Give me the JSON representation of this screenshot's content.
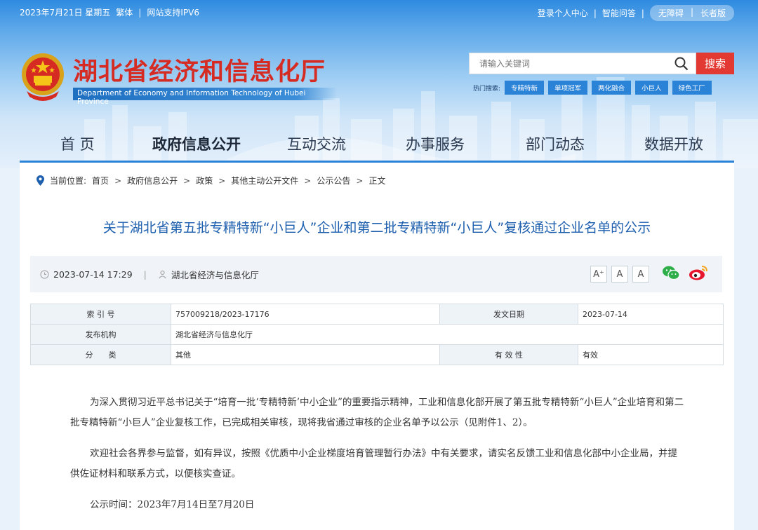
{
  "topbar": {
    "date": "2023年7月21日 星期五",
    "traditional": "繁体",
    "ipv6": "网站支持IPV6",
    "login": "登录个人中心",
    "qa": "智能问答",
    "accessible": "无障碍",
    "elder": "长者版"
  },
  "site": {
    "title": "湖北省经济和信息化厅",
    "subtitle_en": "Department of Economy and Information Technology of Hubei Province"
  },
  "search": {
    "placeholder": "请输入关键词",
    "button": "搜索",
    "hot_label": "热门搜索:",
    "hot_tags": [
      "专精特新",
      "单项冠军",
      "两化融合",
      "小巨人",
      "绿色工厂"
    ]
  },
  "nav": [
    "首 页",
    "政府信息公开",
    "互动交流",
    "办事服务",
    "部门动态",
    "数据开放"
  ],
  "breadcrumb": {
    "label": "当前位置:",
    "items": [
      "首页",
      "政府信息公开",
      "政策",
      "其他主动公开文件",
      "公示公告",
      "正文"
    ]
  },
  "article": {
    "title": "关于湖北省第五批专精特新“小巨人”企业和第二批专精特新“小巨人”复核通过企业名单的公示",
    "datetime": "2023-07-14 17:29",
    "source": "湖北省经济与信息化厅",
    "font_sizes": [
      "A⁺",
      "A",
      "A"
    ]
  },
  "info_table": {
    "index_label": "索 引 号",
    "index_value": "757009218/2023-17176",
    "date_label": "发文日期",
    "date_value": "2023-07-14",
    "org_label": "发布机构",
    "org_value": "湖北省经济与信息化厅",
    "category_label": "分　　类",
    "category_value": "其他",
    "validity_label": "有 效 性",
    "validity_value": "有效"
  },
  "body": {
    "p1": "为深入贯彻习近平总书记关于“培育一批‘专精特新’中小企业”的重要指示精神，工业和信息化部开展了第五批专精特新“小巨人”企业培育和第二批专精特新“小巨人”企业复核工作，已完成相关审核，现将我省通过审核的企业名单予以公示（见附件1、2）。",
    "p2": "欢迎社会各界参与监督，如有异议，按照《优质中小企业梯度培育管理暂行办法》中有关要求，请实名反馈工业和信息化部中小企业局，并提供佐证材料和联系方式，以便核实查证。",
    "p3": "公示时间：2023年7月14日至7月20日"
  },
  "colors": {
    "brand_red": "#d62b23",
    "link_blue": "#1e5fae",
    "tag_blue": "#2b83d8"
  }
}
